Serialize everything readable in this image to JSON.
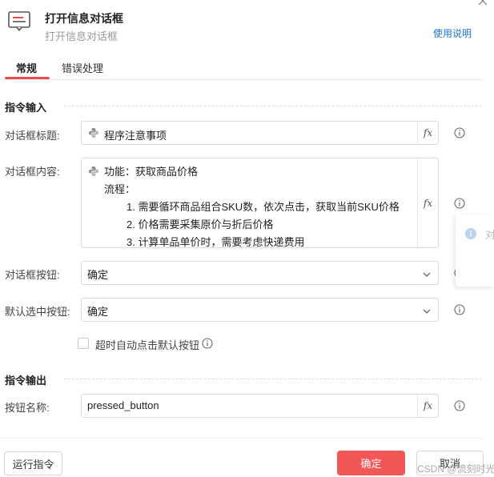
{
  "header": {
    "title": "打开信息对话框",
    "subtitle": "打开信息对话框",
    "help_label": "使用说明"
  },
  "tabs": [
    {
      "label": "常规",
      "active": true
    },
    {
      "label": "错误处理",
      "active": false
    }
  ],
  "sections": {
    "input_title": "指令输入",
    "output_title": "指令输出"
  },
  "fields": {
    "dialog_title": {
      "label": "对话框标题:",
      "value": "程序注意事项"
    },
    "dialog_content": {
      "label": "对话框内容:",
      "lines": [
        "功能：获取商品价格",
        "流程：",
        "1. 需要循环商品组合SKU数，依次点击，获取当前SKU价格",
        "2. 价格需要采集原价与折后价格",
        "3. 计算单品单价时，需要考虑快递费用"
      ]
    },
    "dialog_buttons": {
      "label": "对话框按钮:",
      "value": "确定"
    },
    "default_button": {
      "label": "默认选中按钮:",
      "value": "确定"
    },
    "timeout_checkbox": {
      "label": "超时自动点击默认按钮",
      "checked": false
    },
    "button_name": {
      "label": "按钮名称:",
      "value": "pressed_button"
    }
  },
  "fx_label": "fx",
  "footer": {
    "run_label": "运行指令",
    "ok_label": "确定",
    "cancel_label": "取消",
    "watermark": "CSDN @流刻时光"
  },
  "side_panel": {
    "text": "对"
  },
  "colors": {
    "accent": "#f25757",
    "tab_underline": "#e84c4c",
    "link": "#1e6fd9"
  },
  "icons": {
    "header": "message-box-icon",
    "python": "python-icon",
    "info": "info-icon",
    "chevron": "chevron-down-icon",
    "close": "close-icon"
  }
}
